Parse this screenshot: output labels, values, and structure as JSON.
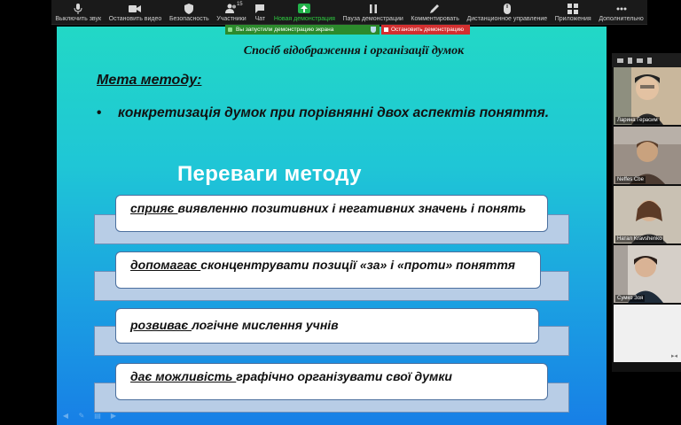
{
  "toolbar": {
    "items": [
      {
        "label": "Выключить звук",
        "icon": "microphone-icon"
      },
      {
        "label": "Остановить видео",
        "icon": "video-camera-icon"
      },
      {
        "label": "Безопасность",
        "icon": "shield-icon"
      },
      {
        "label": "Участники",
        "icon": "participants-icon",
        "count": "15"
      },
      {
        "label": "Чат",
        "icon": "chat-icon"
      },
      {
        "label": "Новая демонстрация",
        "icon": "share-screen-icon"
      },
      {
        "label": "Пауза демонстрации",
        "icon": "pause-icon"
      },
      {
        "label": "Комментировать",
        "icon": "pencil-icon"
      },
      {
        "label": "Дистанционное управление",
        "icon": "mouse-icon"
      },
      {
        "label": "Приложения",
        "icon": "apps-icon"
      },
      {
        "label": "Дополнительно",
        "icon": "more-icon"
      }
    ],
    "accent_color": "#2ecc40"
  },
  "share_banner": {
    "status": "Вы запустили демонстрацию экрана",
    "stop_label": "Остановить демонстрацию",
    "status_color": "#2c8a2c",
    "stop_color": "#d32f2f"
  },
  "slide": {
    "title": "Спосіб відображення і організації думок",
    "goal_heading": "Мета методу:",
    "goal_bullet": "•",
    "goal_text": "конкретизація думок при порівнянні двох аспектів поняття.",
    "advantages_heading": "Переваги методу",
    "advantages": [
      {
        "lead": "сприяє ",
        "rest": "виявленню позитивних і негативних значень і понять"
      },
      {
        "lead": "допомагає ",
        "rest": "сконцентрувати позиції «за» і «проти» поняття"
      },
      {
        "lead": "розвиває ",
        "rest": "логічне мислення учнів"
      },
      {
        "lead": "дає можливість ",
        "rest": "графічно організувати свої думки"
      }
    ]
  },
  "participants": [
    {
      "name": "Ларина Герасим",
      "bg": "#c9b79c"
    },
    {
      "name": "Neffes Cbe",
      "bg": "#9a8f86"
    },
    {
      "name": "Натал Kravshenko",
      "bg": "#c9c1b3"
    },
    {
      "name": "Сумко Зоя",
      "bg": "#d5cfc8"
    }
  ],
  "panel_more": "▸◂"
}
